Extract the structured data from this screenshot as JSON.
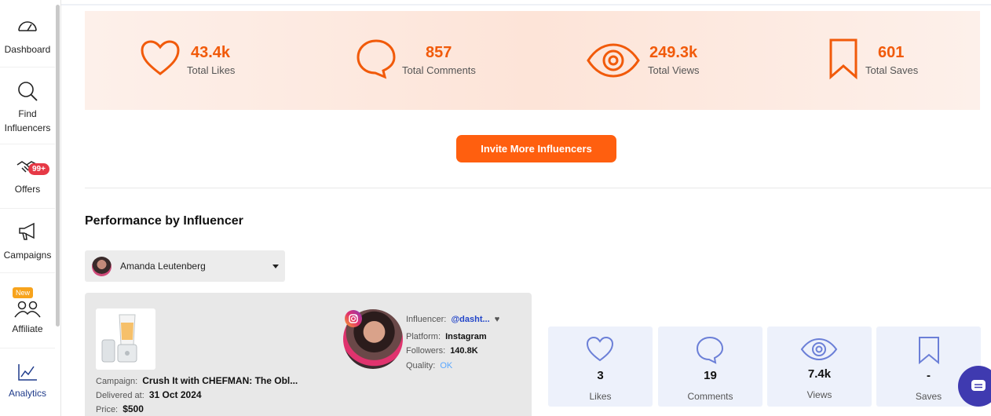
{
  "sidebar": {
    "items": [
      {
        "label": "Dashboard"
      },
      {
        "label": "Find\nInfluencers"
      },
      {
        "label": "Offers",
        "badge": "99+"
      },
      {
        "label": "Campaigns"
      },
      {
        "label": "Affiliate",
        "badge": "New"
      },
      {
        "label": "Analytics"
      }
    ]
  },
  "stats": [
    {
      "value": "43.4k",
      "caption": "Total Likes",
      "icon": "heart-icon"
    },
    {
      "value": "857",
      "caption": "Total Comments",
      "icon": "comment-icon"
    },
    {
      "value": "249.3k",
      "caption": "Total Views",
      "icon": "eye-icon"
    },
    {
      "value": "601",
      "caption": "Total Saves",
      "icon": "bookmark-icon"
    }
  ],
  "invite_button": "Invite More Influencers",
  "performance": {
    "title": "Performance by Influencer",
    "selected_influencer": "Amanda Leutenberg"
  },
  "post": {
    "campaign_label": "Campaign:",
    "campaign_value": "Crush It with CHEFMAN: The Obl...",
    "delivered_label": "Delivered at:",
    "delivered_value": "31 Oct 2024",
    "price_label": "Price:",
    "price_value": "$500",
    "influencer_label": "Influencer:",
    "influencer_value": "@dasht...",
    "platform_label": "Platform:",
    "platform_value": "Instagram",
    "followers_label": "Followers:",
    "followers_value": "140.8K",
    "quality_label": "Quality:",
    "quality_value": "OK"
  },
  "metrics": [
    {
      "value": "3",
      "caption": "Likes",
      "icon": "heart-icon"
    },
    {
      "value": "19",
      "caption": "Comments",
      "icon": "comment-icon"
    },
    {
      "value": "7.4k",
      "caption": "Views",
      "icon": "eye-icon"
    },
    {
      "value": "-",
      "caption": "Saves",
      "icon": "bookmark-icon"
    }
  ],
  "colors": {
    "accent": "#ff5f0f",
    "metric_icon": "#6b7fd7",
    "chat": "#3f3ab0"
  }
}
